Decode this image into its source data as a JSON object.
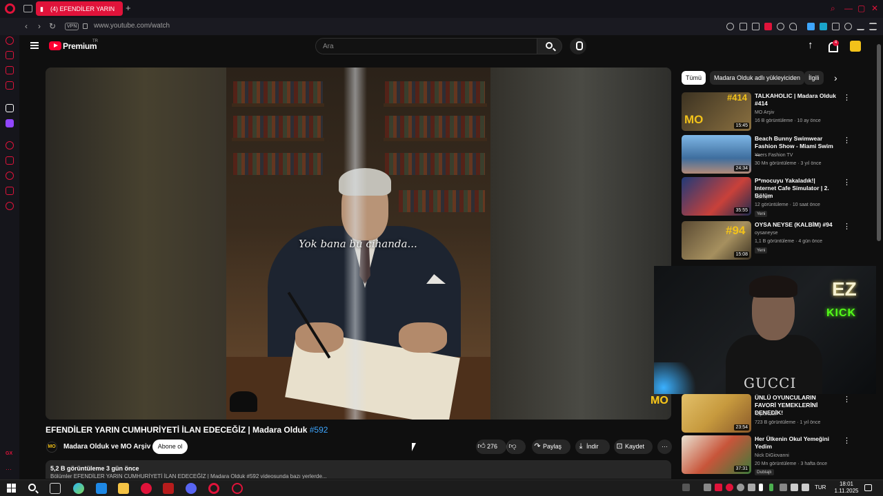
{
  "browser": {
    "tab_title": "(4) EFENDİLER YARIN",
    "new_tab": "+",
    "url": "www.youtube.com/watch",
    "vpn_label": "VPN",
    "back": "‹",
    "forward": "›",
    "reload": "↻",
    "minimize": "—",
    "maximize": "▢",
    "close": "✕",
    "accent": "#e0133a"
  },
  "youtube_header": {
    "brand": "Premium",
    "region": "TR",
    "search_placeholder": "Ara",
    "notification_count": "4"
  },
  "video": {
    "caption": "Yok bana bu cihanda...",
    "watermark": "MO",
    "title": "EFENDİLER YARIN CUMHURİYETİ İLAN EDECEĞİZ | Madara Olduk",
    "hashtag": "#592",
    "channel_avatar": "MO",
    "channel_name": "Madara Olduk ve MO Arşiv",
    "subscribe_label": "Abone ol",
    "like_count": "276",
    "share_label": "Paylaş",
    "download_label": "İndir",
    "save_label": "Kaydet",
    "more_label": "···",
    "views_and_date": "5,2 B görüntüleme  3 gün önce",
    "description_preview": "Bölümler EFENDİLER YARIN CUMHURİYETİ İLAN EDECEĞİZ | Madara Olduk #592 videosunda bazı yerlerde..."
  },
  "chips": [
    {
      "label": "Tümü",
      "active": true
    },
    {
      "label": "Madara Olduk adlı yükleyiciden",
      "active": false
    },
    {
      "label": "İlgili",
      "active": false
    }
  ],
  "recommendations": [
    {
      "title": "TALKAHOLIC | Madara Olduk #414",
      "channel": "MO Arşiv",
      "meta": "16 B görüntüleme · 10 ay önce",
      "duration": "15:45",
      "badge": "",
      "thumb_color": "#6b5a3c"
    },
    {
      "title": "Beach Bunny Swimwear Fashion Show - Miami Swim ...",
      "channel": "Yaers Fashion TV",
      "meta": "30 Mn görüntüleme · 3 yıl önce",
      "duration": "24:34",
      "badge": "",
      "thumb_color": "#4f8fc4"
    },
    {
      "title": "P*mocuyu Yakaladık!| Internet Cafe Simulator | 2. Bölüm",
      "channel": "Valmyn",
      "meta": "12 görüntüleme · 10 saat önce",
      "duration": "35:55",
      "badge": "Yeni",
      "thumb_color": "#2d4e8f"
    },
    {
      "title": "OYSA NEYSE (KALBİM) #94",
      "channel": "oysaneyse",
      "meta": "1,1 B görüntüleme · 4 gün önce",
      "duration": "15:08",
      "badge": "Yeni",
      "thumb_color": "#7a6a4a"
    },
    {
      "title": "ÜNLÜ OYUNCULARIN FAVORİ YEMEKLERİNİ DENEDİK!",
      "channel": "TepkiKolik",
      "meta": "723 B görüntüleme · 1 yıl önce",
      "duration": "23:54",
      "badge": "",
      "thumb_color": "#c7a14a"
    },
    {
      "title": "Her Ülkenin Okul Yemeğini Yedim",
      "channel": "Nick DiGiovanni",
      "meta": "20 Mn görüntüleme · 3 hafta önce",
      "duration": "37:31",
      "badge": "Dublajlı",
      "thumb_color": "#c8553a"
    }
  ],
  "webcam": {
    "neon_logo": "EZ",
    "neon_text": "KICK",
    "shirt_print": "GUCCI",
    "watermark": "MO"
  },
  "taskbar": {
    "lang": "TUR",
    "time": "18:01",
    "date": "1.11.2025"
  }
}
